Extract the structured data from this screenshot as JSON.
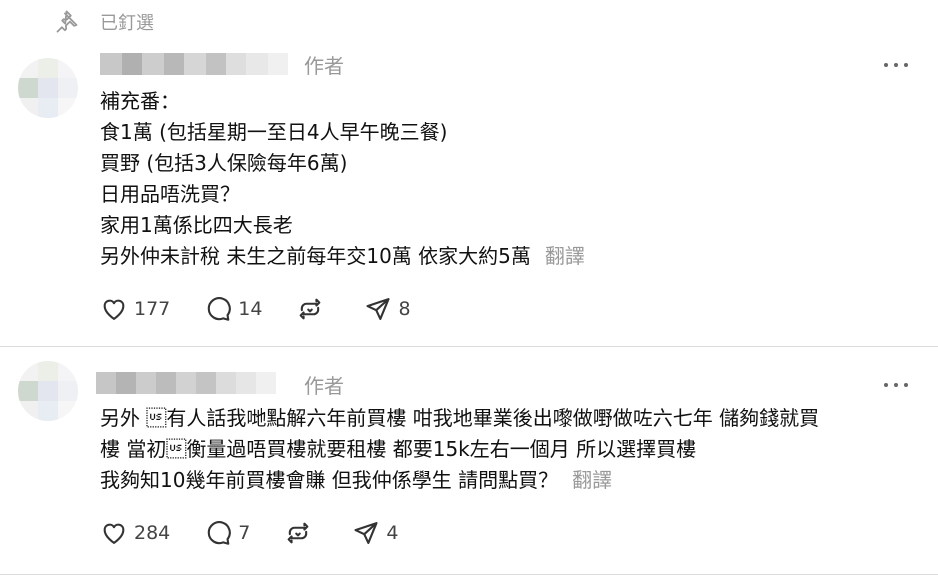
{
  "pinned": {
    "label": "已釘選",
    "icon": "pin-icon"
  },
  "posts": [
    {
      "author_badge": "作者",
      "lines": [
        "補充番：",
        "食1萬 (包括星期一至日4人早午晚三餐)",
        "買野 (包括3人保險每年6萬)",
        "日用品唔洗買？",
        "家用1萬係比四大長老",
        "另外仲未計稅 未生之前每年交10萬 依家大約5萬"
      ],
      "translate_label": "翻譯",
      "likes": "177",
      "comments": "14",
      "reposts": "",
      "shares": "8"
    },
    {
      "author_badge": "作者",
      "lines": [
        "另外 \u001f有人話我哋點解六年前買樓 咁我地畢業後出嚟做嘢做咗六七年 儲夠錢就買",
        "樓 當初\u001f衡量過唔買樓就要租樓 都要15k左右一個月 所以選擇買樓",
        "我夠知10幾年前買樓會賺 但我仲係學生 請問點買？"
      ],
      "translate_label": "翻譯",
      "likes": "284",
      "comments": "7",
      "reposts": "",
      "shares": "4"
    }
  ],
  "colors": {
    "muted": "#999999",
    "text": "#111111",
    "divider": "#dcdcdc"
  }
}
